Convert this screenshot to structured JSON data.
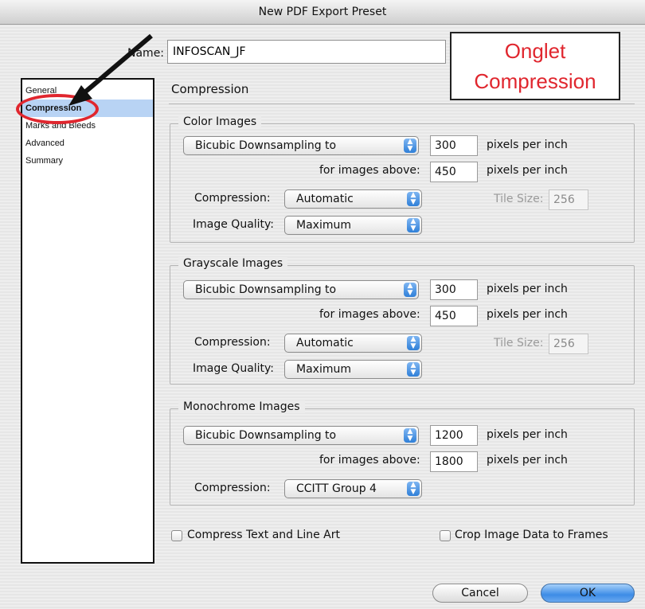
{
  "window": {
    "title": "New PDF Export Preset"
  },
  "name_field": {
    "label": "Name:",
    "value": "INFOSCAN_JF"
  },
  "annotation": {
    "text": "Onglet\nCompression",
    "color": "#e0262e"
  },
  "sidebar": {
    "items": [
      {
        "label": "General"
      },
      {
        "label": "Compression",
        "selected": true
      },
      {
        "label": "Marks and Bleeds"
      },
      {
        "label": "Advanced"
      },
      {
        "label": "Summary"
      }
    ]
  },
  "section": {
    "title": "Compression"
  },
  "color_images": {
    "legend": "Color Images",
    "downsampling": "Bicubic Downsampling to",
    "ppi_value": "300",
    "ppi_unit": "pixels per inch",
    "above_label": "for images above:",
    "above_value": "450",
    "above_unit": "pixels per inch",
    "compression_label": "Compression:",
    "compression_value": "Automatic",
    "tile_label": "Tile Size:",
    "tile_value": "256",
    "quality_label": "Image Quality:",
    "quality_value": "Maximum"
  },
  "grayscale_images": {
    "legend": "Grayscale Images",
    "downsampling": "Bicubic Downsampling to",
    "ppi_value": "300",
    "ppi_unit": "pixels per inch",
    "above_label": "for images above:",
    "above_value": "450",
    "above_unit": "pixels per inch",
    "compression_label": "Compression:",
    "compression_value": "Automatic",
    "tile_label": "Tile Size:",
    "tile_value": "256",
    "quality_label": "Image Quality:",
    "quality_value": "Maximum"
  },
  "mono_images": {
    "legend": "Monochrome Images",
    "downsampling": "Bicubic Downsampling to",
    "ppi_value": "1200",
    "ppi_unit": "pixels per inch",
    "above_label": "for images above:",
    "above_value": "1800",
    "above_unit": "pixels per inch",
    "compression_label": "Compression:",
    "compression_value": "CCITT Group 4"
  },
  "checkboxes": {
    "compress_text": {
      "label": "Compress Text and Line Art",
      "checked": false
    },
    "crop_image": {
      "label": "Crop Image Data to Frames",
      "checked": false
    }
  },
  "buttons": {
    "cancel": "Cancel",
    "ok": "OK"
  },
  "colors": {
    "accent": "#3d8ce6",
    "selection": "#b8d3f4",
    "annotation": "#e0262e"
  }
}
